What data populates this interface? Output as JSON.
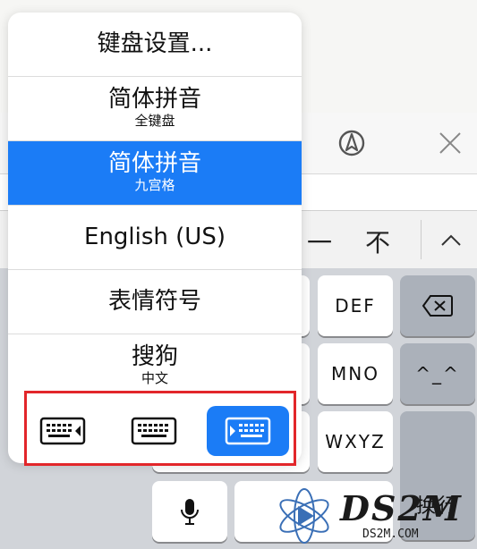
{
  "menu": {
    "items": [
      {
        "title": "键盘设置...",
        "subtitle": ""
      },
      {
        "title": "简体拼音",
        "subtitle": "全键盘"
      },
      {
        "title": "简体拼音",
        "subtitle": "九宫格",
        "selected": true
      },
      {
        "title": "English (US)",
        "subtitle": ""
      },
      {
        "title": "表情符号",
        "subtitle": ""
      },
      {
        "title": "搜狗",
        "subtitle": "中文"
      }
    ],
    "switchers": [
      "keyboard-left-icon",
      "keyboard-full-icon",
      "keyboard-right-icon"
    ],
    "active_switcher": 2
  },
  "candidates": {
    "items": [
      "一",
      "不"
    ],
    "expand_icon": "chevron-up-icon"
  },
  "keys": {
    "def": "DEF",
    "mno": "MNO",
    "wxyz": "WXYZ",
    "emoticon": "^_^",
    "return": "换行"
  },
  "watermark": {
    "text": "DS2M",
    "sub": "DS2M.COM"
  },
  "colors": {
    "accent": "#1b7cf6",
    "highlight_border": "#e2262a"
  }
}
